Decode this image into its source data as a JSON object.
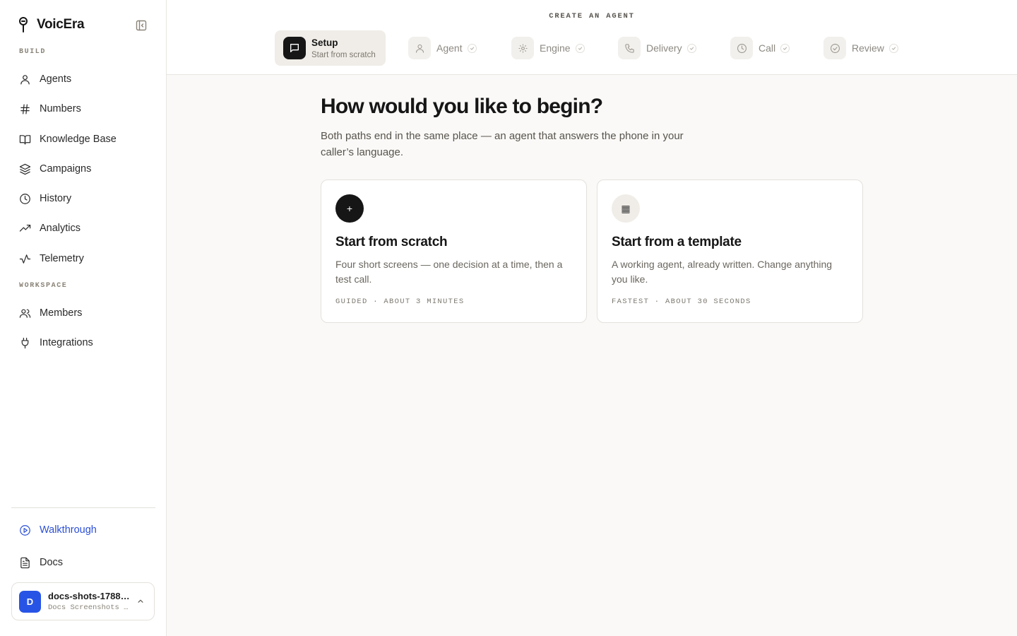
{
  "brand": {
    "name": "VoicEra"
  },
  "sidebar": {
    "build_label": "BUILD",
    "workspace_label": "WORKSPACE",
    "build_items": [
      {
        "label": "Agents",
        "icon": "user-icon"
      },
      {
        "label": "Numbers",
        "icon": "hash-icon"
      },
      {
        "label": "Knowledge Base",
        "icon": "book-icon"
      },
      {
        "label": "Campaigns",
        "icon": "layers-icon"
      },
      {
        "label": "History",
        "icon": "clock-icon"
      },
      {
        "label": "Analytics",
        "icon": "trending-up-icon"
      },
      {
        "label": "Telemetry",
        "icon": "activity-icon"
      }
    ],
    "workspace_items": [
      {
        "label": "Members",
        "icon": "users-icon"
      },
      {
        "label": "Integrations",
        "icon": "plug-icon"
      }
    ],
    "footer_items": [
      {
        "label": "Walkthrough",
        "icon": "play-circle-icon"
      },
      {
        "label": "Docs",
        "icon": "file-text-icon"
      }
    ],
    "account": {
      "initial": "D",
      "name": "docs-shots-1788…",
      "subtitle": "Docs Screenshots …"
    }
  },
  "header": {
    "title": "CREATE AN AGENT",
    "steps": [
      {
        "label": "Setup",
        "sublabel": "Start from scratch",
        "active": true,
        "icon": "message-square-icon"
      },
      {
        "label": "Agent",
        "icon": "user-icon"
      },
      {
        "label": "Engine",
        "icon": "gear-icon"
      },
      {
        "label": "Delivery",
        "icon": "phone-icon"
      },
      {
        "label": "Call",
        "icon": "clock-icon"
      },
      {
        "label": "Review",
        "icon": "check-circle-icon"
      }
    ]
  },
  "main": {
    "heading": "How would you like to begin?",
    "lede": "Both paths end in the same place — an agent that answers the phone in your caller’s language.",
    "options": [
      {
        "icon": "plus-icon",
        "icon_glyph": "+",
        "title": "Start from scratch",
        "description": "Four short screens — one decision at a time, then a test call.",
        "meta": "GUIDED · ABOUT 3 MINUTES"
      },
      {
        "icon": "grid-icon",
        "icon_glyph": "▦",
        "title": "Start from a template",
        "description": "A working agent, already written. Change anything you like.",
        "meta": "FASTEST · ABOUT 30 SECONDS"
      }
    ]
  },
  "colors": {
    "accent_blue": "#2b4fd6",
    "avatar_blue": "#2854e6",
    "dark": "#161616",
    "page_bg": "#faf9f7"
  }
}
